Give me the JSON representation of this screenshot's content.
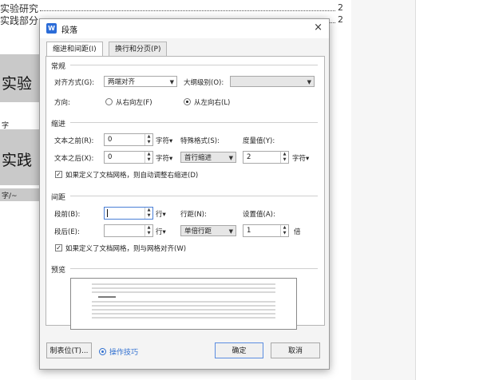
{
  "document": {
    "toc": [
      {
        "text": "实验研究",
        "page": "2"
      },
      {
        "text": "实践部分",
        "page": "2"
      }
    ],
    "headings": [
      "实验",
      "实践"
    ],
    "fragments": [
      "字",
      "字/~"
    ]
  },
  "dialog": {
    "title": "段落",
    "app_icon": "W",
    "close": "×",
    "tabs": [
      "缩进和间距(I)",
      "换行和分页(P)"
    ],
    "general": {
      "section": "常规",
      "alignment_label": "对齐方式(G):",
      "alignment_value": "两端对齐",
      "outline_label": "大纲级别(O):",
      "outline_value": "",
      "direction_label": "方向:",
      "rtl_label": "从右向左(F)",
      "ltr_label": "从左向右(L)",
      "ltr_selected": true
    },
    "indent": {
      "section": "缩进",
      "before_label": "文本之前(R):",
      "before_value": "0",
      "after_label": "文本之后(X):",
      "after_value": "0",
      "unit": "字符▾",
      "special_label": "特殊格式(S):",
      "special_value": "首行缩进",
      "measure_label": "度量值(Y):",
      "measure_value": "2",
      "measure_unit": "字符▾",
      "auto_adjust_label": "如果定义了文档网格，则自动调整右缩进(D)",
      "auto_adjust_checked": true
    },
    "spacing": {
      "section": "间距",
      "before_label": "段前(B):",
      "before_value": "",
      "before_unit": "行▾",
      "after_label": "段后(E):",
      "after_value": "",
      "after_unit": "行▾",
      "line_label": "行距(N):",
      "line_value": "单倍行距",
      "set_label": "设置值(A):",
      "set_value": "1",
      "set_unit": "倍",
      "snap_label": "如果定义了文档网格，则与网格对齐(W)",
      "snap_checked": true
    },
    "preview": {
      "section": "预览"
    },
    "footer": {
      "tabs_button": "制表位(T)...",
      "tips_link": "操作技巧",
      "ok": "确定",
      "cancel": "取消"
    }
  },
  "colors": {
    "accent": "#2b6cd8",
    "link": "#2f6fd0",
    "doc_gray": "#c9c9c9"
  }
}
